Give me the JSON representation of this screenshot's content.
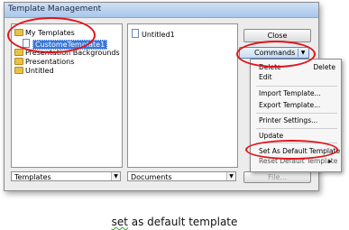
{
  "window": {
    "title": "Template Management"
  },
  "templates_tree": {
    "items": [
      {
        "label": "My Templates",
        "expanded": true
      },
      {
        "label": "CustomeTemplate1",
        "selected": true
      },
      {
        "label": "Presentation Backgrounds"
      },
      {
        "label": "Presentations"
      },
      {
        "label": "Untitled"
      }
    ]
  },
  "documents_list": {
    "items": [
      {
        "label": "Untitled1"
      }
    ]
  },
  "bottom": {
    "left_combo": "Templates",
    "right_combo": "Documents",
    "file_button": "File..."
  },
  "buttons": {
    "close": "Close",
    "commands": "Commands"
  },
  "commands_menu": {
    "items": [
      {
        "label": "Delete",
        "shortcut": "Delete"
      },
      {
        "label": "Edit",
        "shortcut": ""
      },
      {
        "label": "Import Template...",
        "shortcut": ""
      },
      {
        "label": "Export Template...",
        "shortcut": ""
      },
      {
        "label": "Printer Settings...",
        "shortcut": ""
      },
      {
        "label": "Update",
        "shortcut": ""
      },
      {
        "label": "Set As Default Template",
        "shortcut": ""
      },
      {
        "label": "Reset Default Template",
        "shortcut": "▸"
      }
    ]
  },
  "caption": {
    "prefix": "set",
    "rest": " as default template"
  },
  "colors": {
    "highlight": "#e2141a",
    "selection": "#3877d8"
  }
}
